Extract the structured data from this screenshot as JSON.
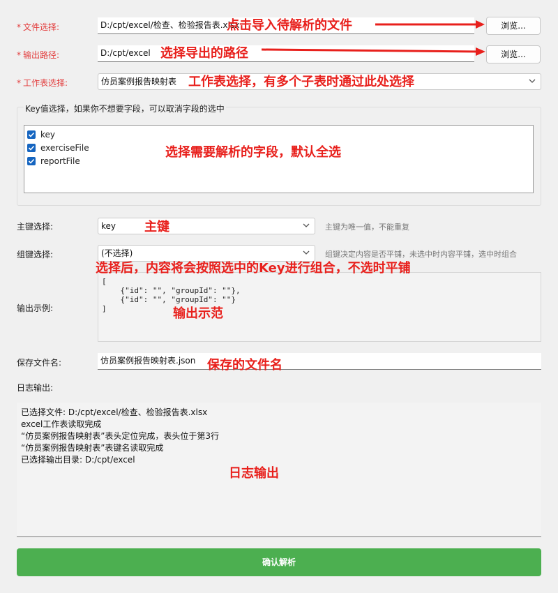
{
  "form": {
    "file": {
      "label": "文件选择:",
      "value": "D:/cpt/excel/检查、检验报告表.xlsx",
      "browse": "浏览..."
    },
    "output": {
      "label": "输出路径:",
      "value": "D:/cpt/excel",
      "browse": "浏览..."
    },
    "sheet": {
      "label": "工作表选择:",
      "value": "仿员案例报告映射表"
    },
    "keys": {
      "group_title": "Key值选择，如果你不想要字段，可以取消字段的选中",
      "items": [
        {
          "label": "key",
          "checked": true
        },
        {
          "label": "exerciseFile",
          "checked": true
        },
        {
          "label": "reportFile",
          "checked": true
        }
      ]
    },
    "primary_key": {
      "label": "主键选择:",
      "value": "key",
      "hint": "主键为唯一值，不能重复"
    },
    "group_key": {
      "label": "组键选择:",
      "value": "(不选择)",
      "hint": "组键决定内容是否平铺，未选中时内容平铺，选中时组合"
    },
    "example": {
      "label": "输出示例:",
      "lines": [
        "[",
        "    {\"id\": \"\", \"groupId\": \"\"},",
        "    {\"id\": \"\", \"groupId\": \"\"}",
        "]"
      ]
    },
    "save_name": {
      "label": "保存文件名:",
      "value": "仿员案例报告映射表.json"
    },
    "log": {
      "label": "日志输出:",
      "lines": [
        "已选择文件: D:/cpt/excel/检查、检验报告表.xlsx",
        "excel工作表读取完成",
        "“仿员案例报告映射表”表头定位完成，表头位于第3行",
        "“仿员案例报告映射表”表键名读取完成",
        "已选择输出目录: D:/cpt/excel"
      ]
    },
    "confirm_button": "确认解析",
    "required_mark": "*"
  },
  "annotations": {
    "file": "点击导入待解析的文件",
    "output": "选择导出的路径",
    "sheet": "工作表选择，有多个子表时通过此处选择",
    "keys": "选择需要解析的字段，默认全选",
    "primary": "主键",
    "group": "选择后，内容将会按照选中的Key进行组合，不选时平铺",
    "example": "输出示范",
    "save": "保存的文件名",
    "log": "日志输出"
  },
  "colors": {
    "annotation": "#e8201c",
    "checkbox": "#1565c0",
    "confirm": "#4caf50",
    "required": "#e23b3b"
  },
  "icons": [
    "chevron-down-icon",
    "check-icon",
    "arrow-right-icon"
  ]
}
